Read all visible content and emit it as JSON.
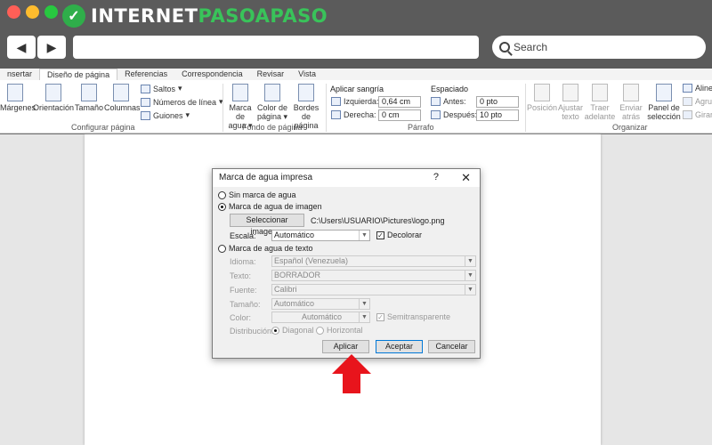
{
  "site": {
    "logo_left": "INTERNET",
    "logo_right": "PASOAPASO",
    "search_placeholder": "Search"
  },
  "ribbon": {
    "tabs": [
      "nsertar",
      "Diseño de página",
      "Referencias",
      "Correspondencia",
      "Revisar",
      "Vista"
    ],
    "config": {
      "margenes": "Márgenes",
      "orientacion": "Orientación",
      "tamano": "Tamaño",
      "columnas": "Columnas",
      "saltos": "Saltos",
      "numeros": "Números de línea",
      "guiones": "Guiones",
      "group": "Configurar página"
    },
    "fondo": {
      "marca1": "Marca de",
      "marca2": "agua",
      "color1": "Color de",
      "color2": "página",
      "bordes1": "Bordes de",
      "bordes2": "página",
      "group": "Fondo de página"
    },
    "parrafo": {
      "sangria": "Aplicar sangría",
      "espaciado": "Espaciado",
      "izquierda": "Izquierda:",
      "izq_val": "0,64 cm",
      "derecha": "Derecha:",
      "der_val": "0 cm",
      "antes": "Antes:",
      "antes_val": "0 pto",
      "despues": "Después:",
      "despues_val": "10 pto",
      "group": "Párrafo"
    },
    "organizar": {
      "posicion": "Posición",
      "ajustar1": "Ajustar",
      "ajustar2": "texto",
      "traer1": "Traer",
      "traer2": "adelante",
      "enviar1": "Enviar",
      "enviar2": "atrás",
      "panel1": "Panel de",
      "panel2": "selección",
      "alinear": "Aline",
      "agrupar": "Agrup",
      "girar": "Girar",
      "group": "Organizar"
    }
  },
  "dialog": {
    "title": "Marca de agua impresa",
    "help": "?",
    "close": "✕",
    "no_mark": "Sin marca de agua",
    "image_mark": "Marca de agua de imagen",
    "select_image": "Seleccionar imagen...",
    "image_path": "C:\\Users\\USUARIO\\Pictures\\logo.png",
    "scale_label": "Escala:",
    "scale_value": "Automático",
    "decolor": "Decolorar",
    "text_mark": "Marca de agua de texto",
    "language_label": "Idioma:",
    "language_value": "Español (Venezuela)",
    "text_label": "Texto:",
    "text_value": "BORRADOR",
    "font_label": "Fuente:",
    "font_value": "Calibri",
    "size_label": "Tamaño:",
    "size_value": "Automático",
    "color_label": "Color:",
    "color_value": "Automático",
    "semitransparent": "Semitransparente",
    "layout_label": "Distribución:",
    "diagonal": "Diagonal",
    "horizontal": "Horizontal",
    "apply": "Aplicar",
    "accept": "Aceptar",
    "cancel": "Cancelar"
  },
  "colors": {
    "mac_red": "#ff5f57",
    "mac_yellow": "#febc2e",
    "mac_green": "#28c840",
    "arrow_red": "#e8141c"
  }
}
